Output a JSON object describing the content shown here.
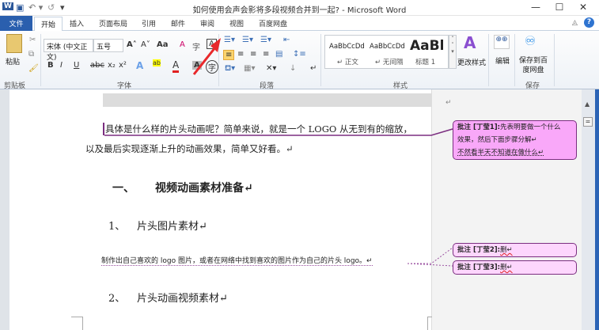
{
  "titlebar": {
    "title": "如何使用会声会影将多段视频合并到一起? - Microsoft Word",
    "qa_word": "W",
    "qa_save": "▣",
    "qa_undo": "↶ ▾",
    "qa_redo": "↺",
    "qa_custom": "▾",
    "minimize": "—",
    "maximize": "☐",
    "close": "✕"
  },
  "tabs": {
    "file": "文件",
    "items": [
      "开始",
      "插入",
      "页面布局",
      "引用",
      "邮件",
      "审阅",
      "视图",
      "百度网盘"
    ],
    "help": "?",
    "ribbon_min": "◬"
  },
  "ribbon": {
    "clipboard": {
      "paste": "粘贴",
      "label": "剪贴板"
    },
    "font": {
      "name": "宋体 (中文正文)",
      "size": "五号",
      "label": "字体",
      "bold": "B",
      "italic": "I",
      "underline": "U",
      "strike": "abc",
      "sub": "x₂",
      "sup": "x²",
      "grow": "A˄",
      "shrink": "A˅",
      "case": "Aa",
      "clear": "A",
      "color": "A",
      "border": "A",
      "phonetic": "字"
    },
    "paragraph": {
      "label": "段落"
    },
    "styles": {
      "label": "样式",
      "items": [
        {
          "preview": "AaBbCcDd",
          "name": "↵ 正文"
        },
        {
          "preview": "AaBbCcDd",
          "name": "↵ 无间隔"
        },
        {
          "preview": "AaBb",
          "name": "标题 1"
        }
      ],
      "change": "更改样式"
    },
    "editing": {
      "label": "编辑"
    },
    "save": {
      "button": "保存到百度网盘",
      "label": "保存"
    }
  },
  "document": {
    "para1_line1": "具体是什么样的片头动画呢？简单来说，就是一个 LOGO 从无到有的缩放，",
    "para1_line2": "以及最后实现逐渐上升的动画效果，简单又好看。↵",
    "heading1_num": "一、",
    "heading1": "视频动画素材准备↵",
    "heading2_num": "1、",
    "heading2": "片头图片素材↵",
    "para2": "制作出自己喜欢的 logo 图片，或者在网络中找到喜欢的图片作为自己的片头 logo。↵",
    "heading3_num": "2、",
    "heading3": "片头动画视频素材↵",
    "end_mark": "↵"
  },
  "comments": [
    {
      "label": "批注 [丁莹1]:",
      "lines": [
        "先表明要做一个什么",
        "效果，然后下面步骤分解↵",
        "不然看半天不知道在做什么↵"
      ],
      "color": "#f9a8f9"
    },
    {
      "label": "批注 [丁莹2]:",
      "lines": [
        "删↵"
      ],
      "color": "#fdd6fd"
    },
    {
      "label": "批注 [丁莹3]:",
      "lines": [
        "删↵"
      ],
      "color": "#fdd6fd"
    }
  ],
  "colors": {
    "accent": "#2a5fae",
    "comment_border": "#7b2e80",
    "arrow": "#e8282b"
  }
}
